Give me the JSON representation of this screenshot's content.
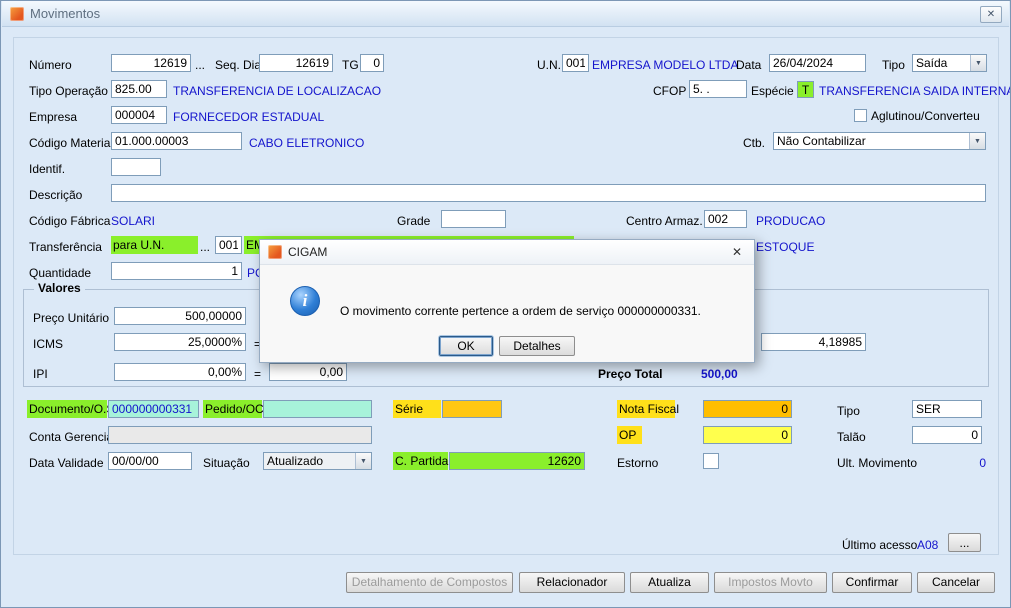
{
  "window": {
    "title": "Movimentos",
    "close_icon": "✕"
  },
  "form": {
    "numero_label": "Número",
    "numero": "12619",
    "numero_browse": "...",
    "seq_dia_label": "Seq. Dia",
    "seq_dia": "12619",
    "tg_label": "TG",
    "tg": "0",
    "un_label": "U.N.",
    "un_code": "001",
    "un_name": "EMPRESA MODELO LTDA",
    "data_label": "Data",
    "data": "26/04/2024",
    "tipo_label": "Tipo",
    "tipo": "Saída",
    "tipo_operacao_label": "Tipo Operação",
    "tipo_operacao": "825.00",
    "tipo_operacao_desc": "TRANSFERENCIA DE LOCALIZACAO",
    "cfop_label": "CFOP",
    "cfop": "5. .",
    "especie_label": "Espécie",
    "especie": "T",
    "especie_desc": "TRANSFERENCIA SAIDA INTERNA",
    "empresa_label": "Empresa",
    "empresa": "000004",
    "empresa_desc": "FORNECEDOR ESTADUAL",
    "aglutinou_label": "Aglutinou/Converteu",
    "codigo_material_label": "Código Material",
    "codigo_material": "01.000.00003",
    "codigo_material_desc": "CABO  ELETRONICO",
    "ctb_label": "Ctb.",
    "ctb": "Não Contabilizar",
    "identif_label": "Identif.",
    "descricao_label": "Descrição",
    "codigo_fabrica_label": "Código Fábrica",
    "codigo_fabrica": "SOLARI",
    "grade_label": "Grade",
    "centro_armaz_label": "Centro Armaz.",
    "centro_armaz": "002",
    "centro_armaz_desc": "PRODUCAO",
    "transferencia_label": "Transferência",
    "transferencia_modo": "para U.N.",
    "transferencia_browse": "...",
    "transferencia_un": "001",
    "transferencia_partial": "EM",
    "transferencia_desc": "ESTOQUE",
    "quantidade_label": "Quantidade",
    "quantidade": "1",
    "quantidade_um": "PC"
  },
  "valores": {
    "legend": "Valores",
    "preco_unitario_label": "Preço Unitário",
    "preco_unitario": "500,00000",
    "icms_label": "ICMS",
    "icms": "25,0000%",
    "icms_eq": "=",
    "icms_valor": "4,18985",
    "ipi_label": "IPI",
    "ipi": "0,00%",
    "ipi_eq": "=",
    "ipi_valor": "0,00",
    "preco_total_label": "Preço Total",
    "preco_total": "500,00"
  },
  "dialog": {
    "title": "CIGAM",
    "close_icon": "✕",
    "info_icon": "i",
    "message": "O movimento corrente pertence a ordem de serviço 000000000331.",
    "ok": "OK",
    "detalhes": "Detalhes"
  },
  "bottom": {
    "documento_label": "Documento/O.S",
    "documento": "000000000331",
    "pedido_label": "Pedido/OC",
    "serie_label": "Série",
    "nota_fiscal_label": "Nota Fiscal",
    "nota_fiscal": "0",
    "tipo_label": "Tipo",
    "tipo": "SER",
    "conta_label": "Conta Gerencial",
    "op_label": "OP",
    "op": "0",
    "talao_label": "Talão",
    "talao": "0",
    "data_validade_label": "Data Validade",
    "data_validade": "00/00/00",
    "situacao_label": "Situação",
    "situacao": "Atualizado",
    "c_partida_label": "C. Partida",
    "c_partida": "12620",
    "estorno_label": "Estorno",
    "ult_mov_label": "Ult. Movimento",
    "ult_mov": "0",
    "ultimo_acesso_label": "Último acesso",
    "ultimo_acesso": "A08",
    "ultimo_acesso_browse": "..."
  },
  "buttons": {
    "detalhamento": "Detalhamento de Compostos",
    "relacionador": "Relacionador",
    "atualiza": "Atualiza",
    "impostos": "Impostos Movto",
    "confirmar": "Confirmar",
    "cancelar": "Cancelar"
  },
  "colors": {
    "window_bg": "#dce9f7",
    "blue_text": "#1414cc",
    "lime": "#8AEF2B",
    "cyan": "#A7F3DA",
    "yellow_label": "#FFE01A",
    "gold_input": "#FFC713",
    "orange_field": "#FFBE00",
    "bright_yellow": "#FFFF4D"
  }
}
